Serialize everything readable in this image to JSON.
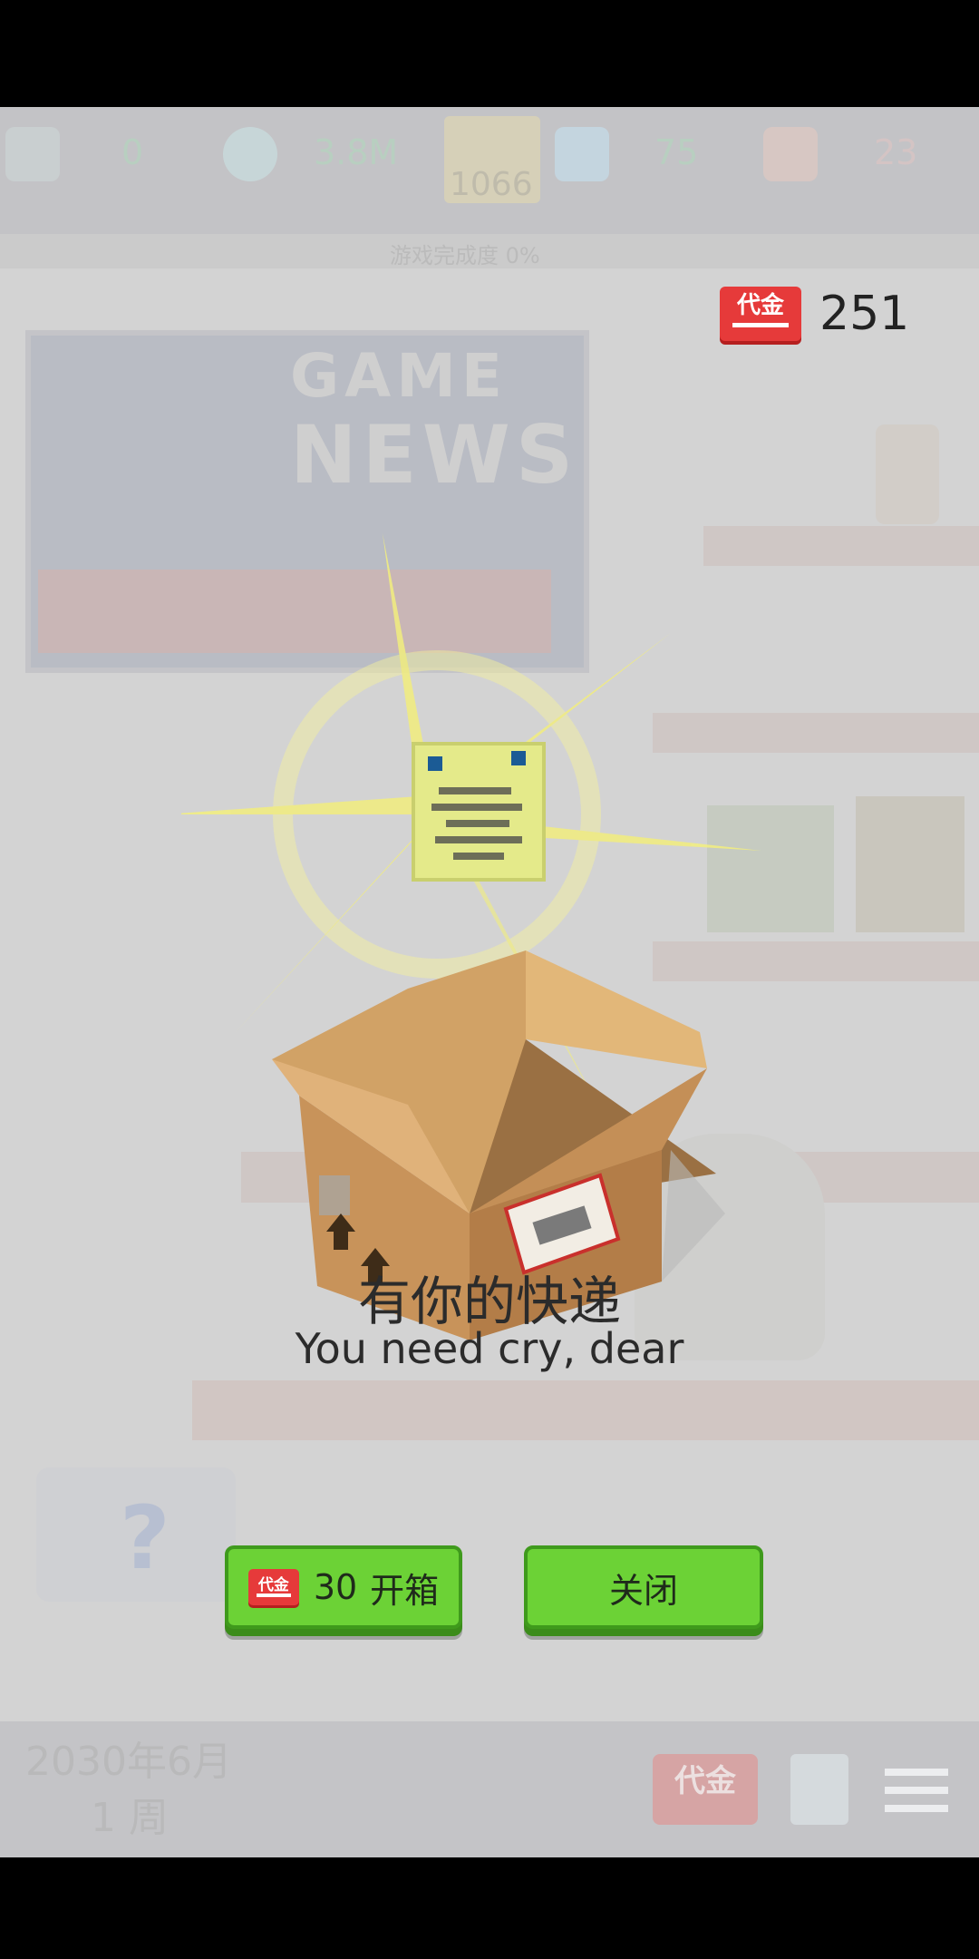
{
  "top_bar": {
    "employees": "0",
    "money": "3.8M",
    "crown_score": "1066",
    "fans": "75",
    "mail_count": "23"
  },
  "progress_label": "游戏完成度    0%",
  "poster": {
    "line1": "GAME",
    "line2": "NEWS"
  },
  "coupon_balance": {
    "icon_text": "代金",
    "amount": "251"
  },
  "popup": {
    "title_cn": "有你的快递",
    "subtitle_en": "You need cry, dear",
    "open_button": {
      "icon_text": "代金",
      "cost": "30",
      "label": "开箱"
    },
    "close_button": {
      "label": "关闭"
    }
  },
  "help_mark": "?",
  "bottom_bar": {
    "date_year_month": "2030年6月",
    "date_week": "1 周",
    "coupon_icon_text": "代金"
  },
  "icons": {
    "employee": "employee-icon",
    "money": "money-bag-icon",
    "crown": "crown-icon",
    "fans": "fans-face-icon",
    "mail": "mail-icon",
    "coupon": "coupon-icon",
    "book": "book-icon",
    "settings": "settings-sliders-icon",
    "package": "package-box-icon"
  },
  "colors": {
    "button_green": "#6cd236",
    "coupon_red": "#e63a3a",
    "spark_yellow": "#f2ee7e"
  }
}
